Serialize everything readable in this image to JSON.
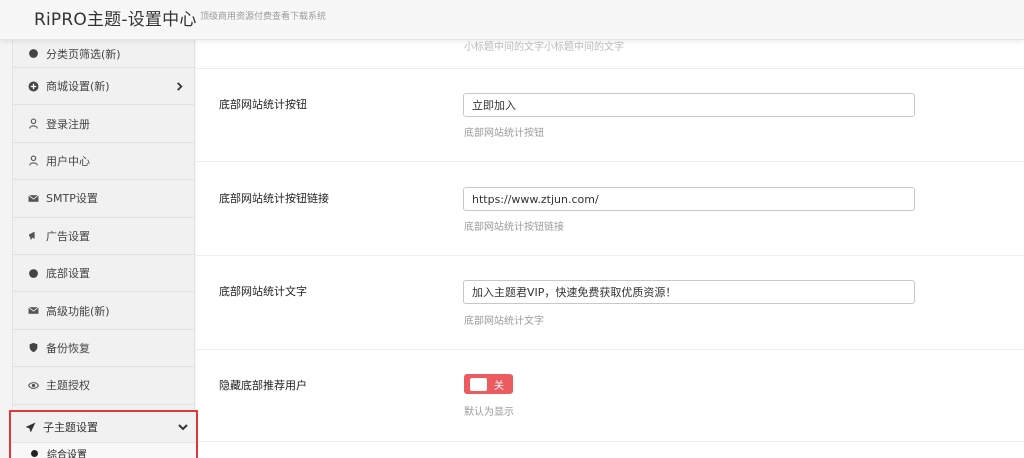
{
  "header": {
    "title": "RiPRO主题-设置中心",
    "subtitle": "顶级商用资源付费查看下载系统"
  },
  "sidebar": {
    "items": [
      {
        "label": "分类页筛选(新)",
        "icon": "dot-icon"
      },
      {
        "label": "商城设置(新)",
        "icon": "circle-plus-icon",
        "has_arrow": true
      },
      {
        "label": "登录注册",
        "icon": "user-icon"
      },
      {
        "label": "用户中心",
        "icon": "user-icon"
      },
      {
        "label": "SMTP设置",
        "icon": "envelope-icon"
      },
      {
        "label": "广告设置",
        "icon": "bullhorn-icon"
      },
      {
        "label": "底部设置",
        "icon": "dot-icon"
      },
      {
        "label": "高级功能(新)",
        "icon": "envelope-icon"
      },
      {
        "label": "备份恢复",
        "icon": "shield-icon"
      },
      {
        "label": "主题授权",
        "icon": "eye-icon"
      }
    ],
    "highlighted": {
      "label": "子主题设置",
      "icon": "paper-plane-icon",
      "sub_label": "综合设置"
    }
  },
  "content": {
    "top_fragment": "小标题中间的文字小标题中间的文字",
    "rows": [
      {
        "label": "底部网站统计按钮",
        "value": "立即加入",
        "help": "底部网站统计按钮"
      },
      {
        "label": "底部网站统计按钮链接",
        "value": "https://www.ztjun.com/",
        "help": "底部网站统计按钮链接"
      },
      {
        "label": "底部网站统计文字",
        "value": "加入主题君VIP，快速免费获取优质资源！",
        "help": "底部网站统计文字"
      }
    ],
    "toggle_row": {
      "label": "隐藏底部推荐用户",
      "toggle_text": "关",
      "help": "默认为显示",
      "state": "off"
    }
  },
  "colors": {
    "highlight_border": "#e0373c",
    "toggle_off": "#eb5b5f"
  }
}
